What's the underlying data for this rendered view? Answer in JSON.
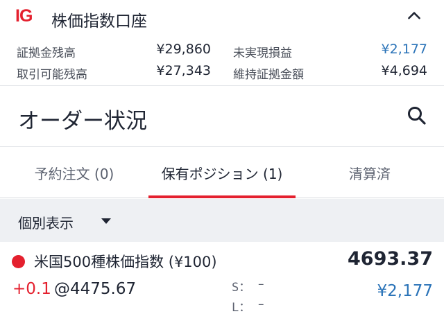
{
  "account": {
    "brand": "IG",
    "title": "株価指数口座",
    "stats": [
      {
        "label": "証拠金残高",
        "value": "¥29,860"
      },
      {
        "label": "未実現損益",
        "value": "¥2,177"
      },
      {
        "label": "取引可能残高",
        "value": "¥27,343"
      },
      {
        "label": "維持証拠金額",
        "value": "¥4,694"
      }
    ],
    "collapse_icon": "chevron-up-icon"
  },
  "orders": {
    "title": "オーダー状況",
    "search_icon": "search-icon"
  },
  "tabs": [
    {
      "label": "予約注文 (0)",
      "active": false
    },
    {
      "label": "保有ポジション (1)",
      "active": true
    },
    {
      "label": "清算済",
      "active": false
    }
  ],
  "colors": {
    "accent": "#e4202e",
    "positive_value": "#2a73b8",
    "text": "#1f2533"
  },
  "filter": {
    "label": "個別表示",
    "icon": "caret-down-icon"
  },
  "position": {
    "name": "米国500種株価指数 (¥100)",
    "price": "4693.37",
    "quantity": "+0.1",
    "entry": "@4475.67",
    "stop_label": "S：",
    "stop_value": "–",
    "limit_label": "L：",
    "limit_value": "–",
    "pnl": "¥2,177"
  }
}
